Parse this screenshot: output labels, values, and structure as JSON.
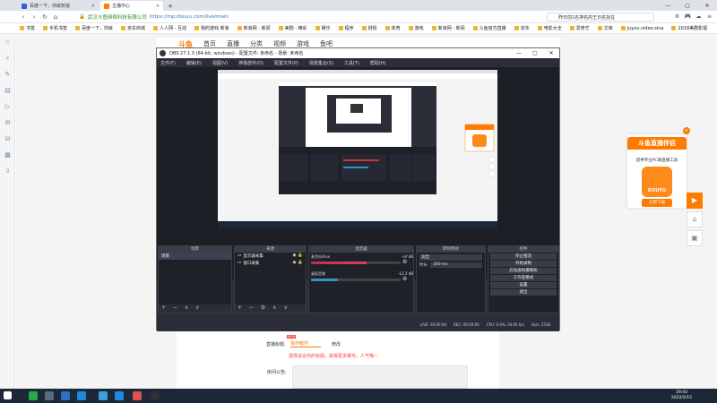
{
  "browser": {
    "tabs": [
      {
        "label": "百度一下，你就知道",
        "active": false
      },
      {
        "label": "主播中心",
        "active": true
      }
    ],
    "address": {
      "site": "武汉斗鱼网络科技有限公司",
      "url": "https://mp.douyu.com/live/main"
    },
    "search_box": "昨日前1名排名的王日名找在",
    "bookmarks": [
      "书签",
      "手机书签",
      "百度一下，你就",
      "京东商城",
      "人人网 - 互动",
      "我的游戏 新浪",
      "新浪网 - 新闻",
      "美剧 - 精彩",
      "娱乐",
      "程序",
      "财经",
      "体育",
      "游戏",
      "新浪网 - 新闻",
      "斗鱼官方直播",
      "京东",
      "电影大全",
      "爱奇艺",
      "文库",
      "juyou.video.sina",
      "2018美剧影视"
    ],
    "sidebar_icons": [
      "star-icon",
      "search-icon",
      "note-icon",
      "bookmark-icon",
      "video-icon",
      "chat-icon",
      "shop-icon",
      "grid-icon",
      "download-icon"
    ]
  },
  "site": {
    "logo": "斗鱼",
    "nav": [
      "首页",
      "直播",
      "分类",
      "视频",
      "游戏",
      "鱼吧"
    ],
    "publish": {
      "title_label": "直播标题:",
      "new_badge": "NEW",
      "title_value": "操作教学",
      "edit_label": "修改",
      "hint": "选择适合你的标题，获得更多曝光，人气哦~",
      "announcement_label": "房间公告:"
    },
    "ad": {
      "title": "斗鱼直播伴侣",
      "subtitle": "提供专业PC端直播工具",
      "app_name": "DOUYU",
      "download": "立即下载"
    },
    "side_tools": [
      "play-icon",
      "home-icon",
      "screen-icon"
    ]
  },
  "obs": {
    "title": "OBS 27.1.3 (64-bit, windows) - 配置文件: 未命名 - 场景: 未命名",
    "menu": [
      "文件(F)",
      "编辑(E)",
      "视图(V)",
      "停靠部件(D)",
      "配置文件(P)",
      "场景集合(S)",
      "工具(T)",
      "帮助(H)"
    ],
    "toolbar": {
      "no_source": "未选择源",
      "properties": "属性",
      "filters": "滤镜"
    },
    "docks": {
      "scenes": {
        "title": "场景",
        "items": [
          "场景"
        ]
      },
      "sources": {
        "title": "来源",
        "items": [
          "显示器采集",
          "窗口采集"
        ]
      },
      "mixer": {
        "title": "混音器",
        "channels": [
          {
            "name": "麦克风/Aux",
            "db": "-inf dB",
            "level": 0.62
          },
          {
            "name": "桌面音频",
            "db": "-12.3 dB",
            "level": 0.3
          }
        ]
      },
      "transitions": {
        "title": "转场特效",
        "type": "淡出",
        "duration_label": "时长",
        "duration": "300 ms"
      },
      "controls": {
        "title": "控件",
        "buttons": [
          "停止推流",
          "开始录制",
          "启动虚拟摄像机",
          "工作室模式",
          "设置",
          "退出"
        ]
      }
    },
    "status": [
      "LIVE: 00:00:00",
      "REC: 00:00:00",
      "CPU: 0.9%, 30.00 fps",
      "kb/s: 2538"
    ]
  },
  "taskbar": {
    "time": "19:43",
    "date": "2022/2/15"
  }
}
